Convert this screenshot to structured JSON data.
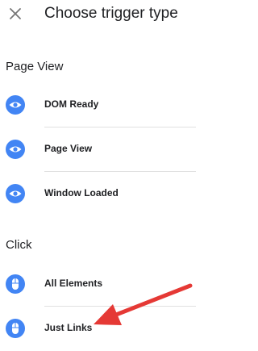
{
  "header": {
    "title": "Choose trigger type",
    "close_icon": "close-icon"
  },
  "colors": {
    "accent": "#4285f4",
    "text": "#202124",
    "divider": "#e0e0e0",
    "annotation": "#e53935"
  },
  "sections": [
    {
      "title": "Page View",
      "items": [
        {
          "label": "DOM Ready",
          "icon": "eye-icon"
        },
        {
          "label": "Page View",
          "icon": "eye-icon"
        },
        {
          "label": "Window Loaded",
          "icon": "eye-icon"
        }
      ]
    },
    {
      "title": "Click",
      "items": [
        {
          "label": "All Elements",
          "icon": "mouse-icon"
        },
        {
          "label": "Just Links",
          "icon": "mouse-icon"
        }
      ]
    }
  ],
  "annotation": {
    "icon": "red-arrow-icon",
    "points_to": "Just Links"
  }
}
